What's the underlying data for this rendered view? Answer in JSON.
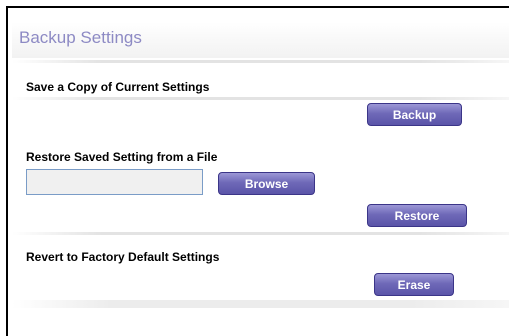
{
  "page": {
    "title": "Backup Settings"
  },
  "sections": {
    "save": {
      "label": "Save a Copy of Current Settings",
      "backup_button": "Backup"
    },
    "restore": {
      "label": "Restore Saved Setting from a File",
      "file_input_value": "",
      "browse_button": "Browse",
      "restore_button": "Restore"
    },
    "revert": {
      "label": "Revert to Factory Default Settings",
      "erase_button": "Erase"
    }
  },
  "colors": {
    "title": "#8d8ac4",
    "button": "#6f69b8",
    "button_border": "#3b3588",
    "input_border": "#7a9cc7"
  }
}
